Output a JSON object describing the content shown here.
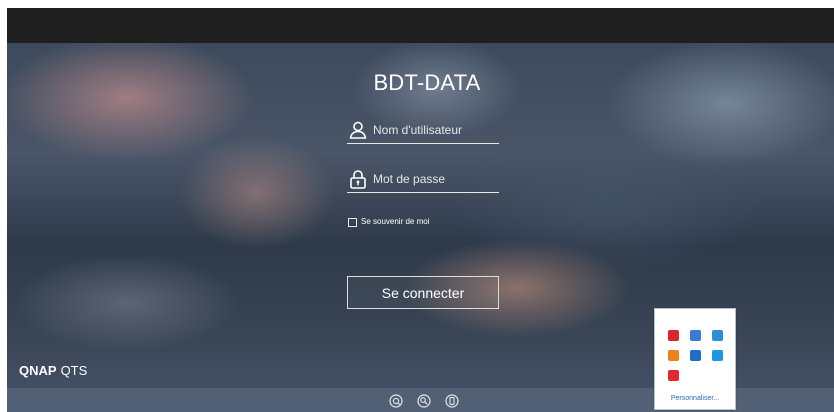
{
  "app": {
    "title": "BDT-DATA",
    "brand_bold": "QNAP",
    "brand_light": "QTS"
  },
  "login": {
    "username_placeholder": "Nom d'utilisateur",
    "password_placeholder": "Mot de passe",
    "remember_label": "Se souvenir de moi",
    "submit_label": "Se connecter"
  },
  "footer": {
    "icons": [
      "qfinder-icon",
      "search-tool-icon",
      "mobile-app-icon"
    ]
  },
  "tray": {
    "icons": [
      {
        "name": "red-app-tray-icon",
        "color": "#d9272e"
      },
      {
        "name": "network-tray-icon",
        "color": "#3a7bd5"
      },
      {
        "name": "monitor-tray-icon",
        "color": "#2b8fd6"
      },
      {
        "name": "orange-app-tray-icon",
        "color": "#f07f1a"
      },
      {
        "name": "outlook-tray-icon",
        "color": "#1f6fc4"
      },
      {
        "name": "sync-tray-icon",
        "color": "#1a98e0"
      },
      {
        "name": "acrobat-tray-icon",
        "color": "#e0282e"
      }
    ],
    "customize_label": "Personnaliser..."
  }
}
